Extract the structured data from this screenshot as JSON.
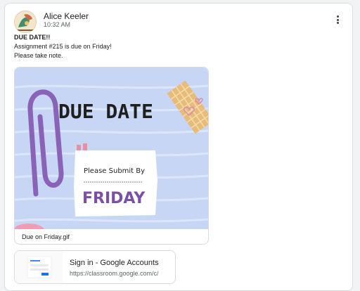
{
  "post": {
    "author": "Alice Keeler",
    "time": "10:32 AM",
    "more_icon": "more-vert-icon",
    "avatar_icon": "avatar-image"
  },
  "message": {
    "title": "DUE DATE!!",
    "line1": "Assignment #215 is due on Friday!",
    "line2": "Please take note."
  },
  "gif_attachment": {
    "heading": "DUE DATE",
    "subheading": "Please Submit By",
    "day": "FRIDAY",
    "filename": "Due on Friday.gif",
    "colors": {
      "background": "#c7d6f5",
      "accent": "#7b4fa3",
      "clip": "#8a62b8",
      "tape": "#e9b96d"
    }
  },
  "link_attachment": {
    "title": "Sign in - Google Accounts",
    "url": "https://classroom.google.com/c/"
  }
}
